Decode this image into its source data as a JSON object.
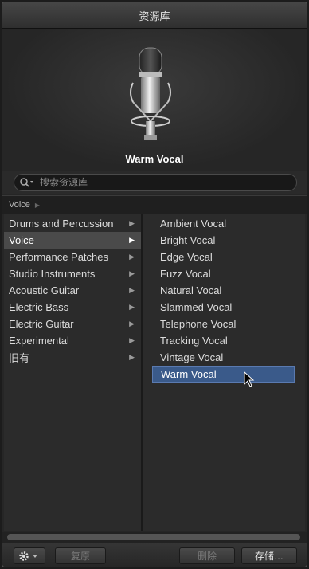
{
  "window": {
    "title": "资源库"
  },
  "preview": {
    "patch_name": "Warm Vocal",
    "icon": "microphone-icon"
  },
  "search": {
    "placeholder": "搜索资源库",
    "icon": "search-icon"
  },
  "breadcrumb": {
    "path": "Voice"
  },
  "categories": [
    {
      "label": "Drums and Percussion",
      "selected": false
    },
    {
      "label": "Voice",
      "selected": true
    },
    {
      "label": "Performance Patches",
      "selected": false
    },
    {
      "label": "Studio Instruments",
      "selected": false
    },
    {
      "label": "Acoustic Guitar",
      "selected": false
    },
    {
      "label": "Electric Bass",
      "selected": false
    },
    {
      "label": "Electric Guitar",
      "selected": false
    },
    {
      "label": "Experimental",
      "selected": false
    },
    {
      "label": "旧有",
      "selected": false
    }
  ],
  "patches": [
    {
      "label": "Ambient Vocal",
      "selected": false
    },
    {
      "label": "Bright Vocal",
      "selected": false
    },
    {
      "label": "Edge Vocal",
      "selected": false
    },
    {
      "label": "Fuzz Vocal",
      "selected": false
    },
    {
      "label": "Natural Vocal",
      "selected": false
    },
    {
      "label": "Slammed Vocal",
      "selected": false
    },
    {
      "label": "Telephone Vocal",
      "selected": false
    },
    {
      "label": "Tracking Vocal",
      "selected": false
    },
    {
      "label": "Vintage Vocal",
      "selected": false
    },
    {
      "label": "Warm Vocal",
      "selected": true
    }
  ],
  "footer": {
    "gear_icon": "gear-icon",
    "revert_label": "复原",
    "delete_label": "删除",
    "save_label": "存储…"
  },
  "colors": {
    "selection": "#3a5a8a",
    "category_selection": "#4a4a4a"
  }
}
